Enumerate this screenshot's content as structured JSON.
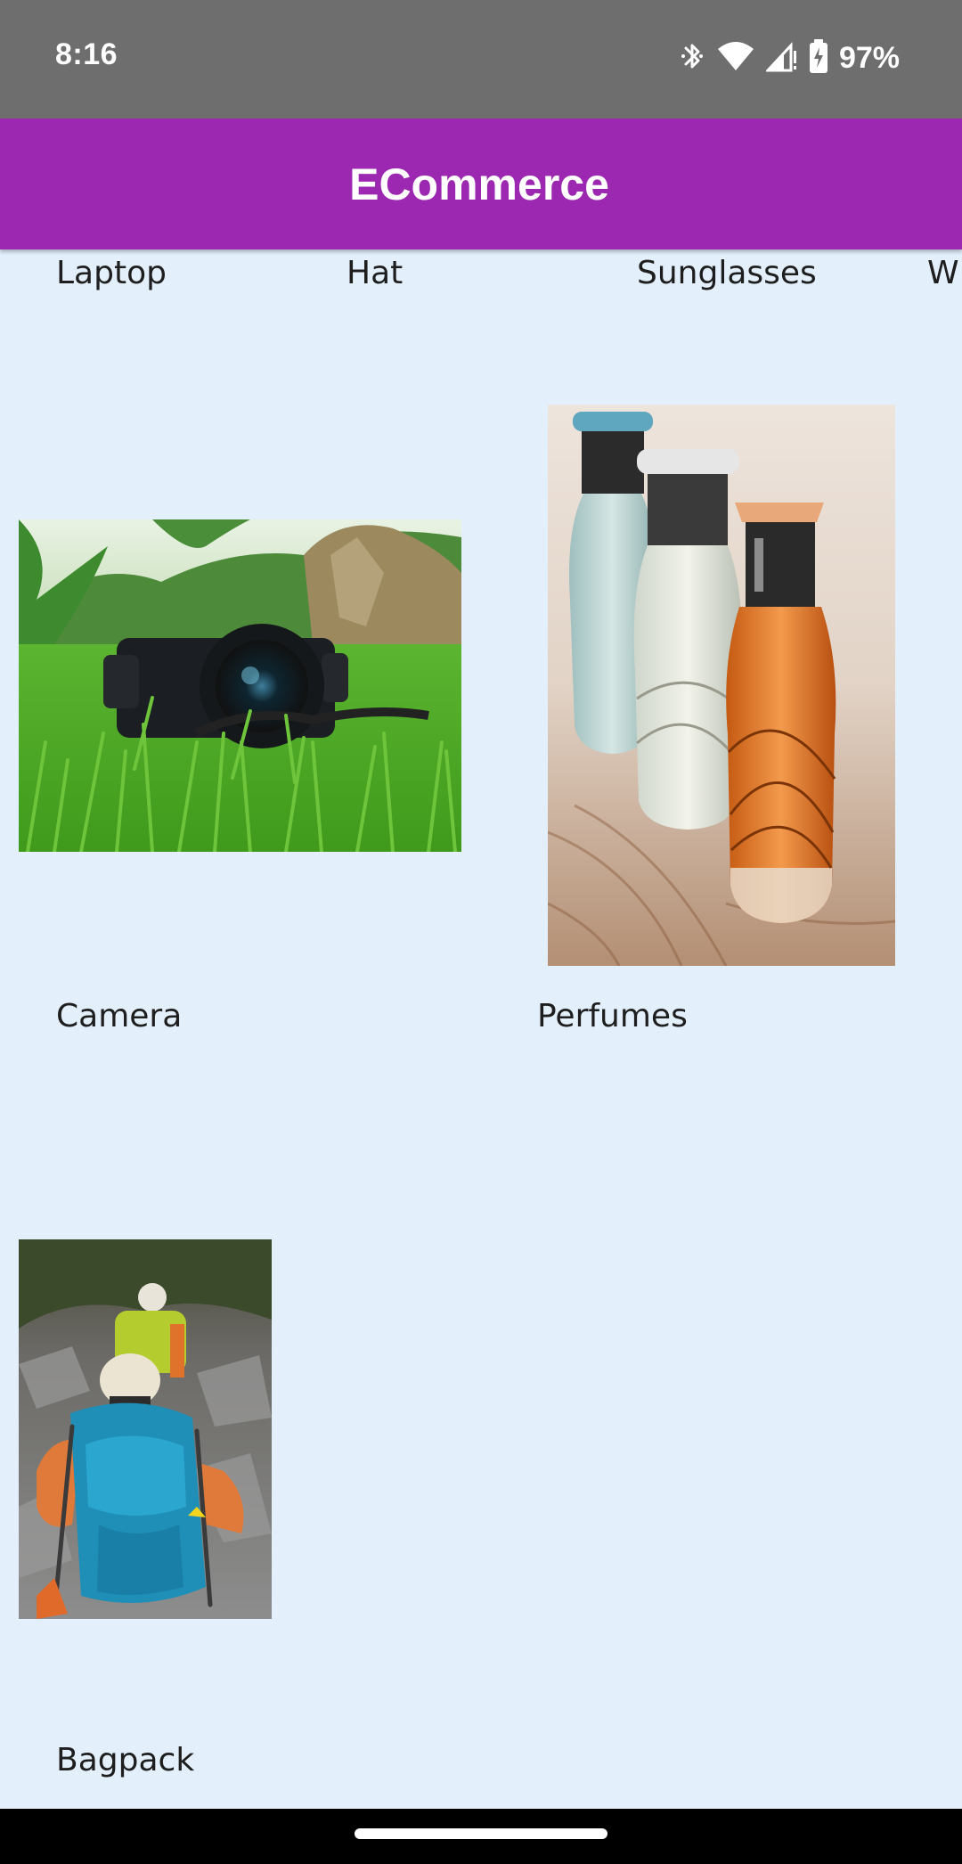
{
  "status_bar": {
    "time": "8:16",
    "battery": "97%",
    "icons": [
      "bluetooth-icon",
      "wifi-icon",
      "cell-signal-icon",
      "battery-charging-icon"
    ]
  },
  "app_bar": {
    "title": "ECommerce"
  },
  "categories": [
    "Laptop",
    "Hat",
    "Sunglasses",
    "W"
  ],
  "products": [
    {
      "name": "Camera"
    },
    {
      "name": "Perfumes"
    },
    {
      "name": "Bagpack"
    }
  ],
  "colors": {
    "app_bar": "#9c27b0",
    "background": "#e3f0fc",
    "status_bar": "#6e6e6e"
  }
}
